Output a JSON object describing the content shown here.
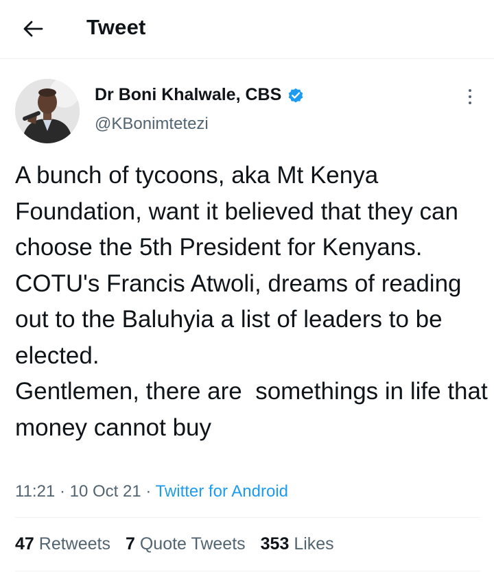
{
  "header": {
    "title": "Tweet",
    "back_icon": "arrow-left-icon"
  },
  "author": {
    "name": "Dr Boni Khalwale, CBS",
    "handle": "@KBonimtetezi",
    "verified_icon": "verified-badge-icon",
    "verified_color": "#1d9bf0"
  },
  "tweet": {
    "text": "A bunch of tycoons, aka Mt Kenya Foundation, want it believed that they can choose the 5th President for Kenyans.\nCOTU's Francis Atwoli, dreams of reading out to the Baluhyia a list of leaders to be elected.\nGentlemen, there are  somethings in life that money cannot buy",
    "time": "11:21",
    "date": "10 Oct 21",
    "separator": " · ",
    "source": "Twitter for Android"
  },
  "stats": {
    "retweets_count": "47",
    "retweets_label": "Retweets",
    "quotes_count": "7",
    "quotes_label": "Quote Tweets",
    "likes_count": "353",
    "likes_label": "Likes"
  },
  "colors": {
    "text_primary": "#0f1419",
    "text_secondary": "#536471",
    "accent": "#1d9bf0",
    "divider": "#eff3f4"
  }
}
